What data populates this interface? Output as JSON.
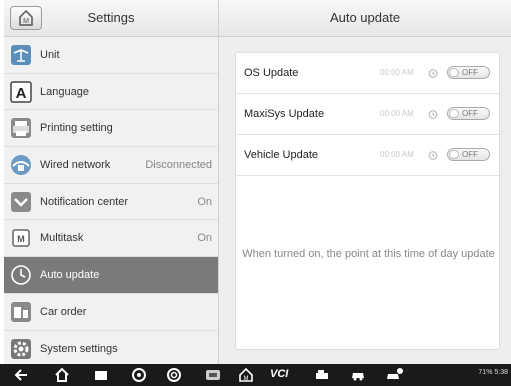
{
  "left_panel": {
    "title": "Settings",
    "items": [
      {
        "label": "Unit",
        "value": "",
        "icon": "scale-icon"
      },
      {
        "label": "Language",
        "value": "",
        "icon": "language-icon"
      },
      {
        "label": "Printing setting",
        "value": "",
        "icon": "printer-icon"
      },
      {
        "label": "Wired network",
        "value": "Disconnected",
        "icon": "network-icon"
      },
      {
        "label": "Notification center",
        "value": "On",
        "icon": "notification-icon"
      },
      {
        "label": "Multitask",
        "value": "On",
        "icon": "multitask-icon"
      },
      {
        "label": "Auto update",
        "value": "",
        "icon": "clock-icon"
      },
      {
        "label": "Car order",
        "value": "",
        "icon": "car-order-icon"
      },
      {
        "label": "System settings",
        "value": "",
        "icon": "gear-icon"
      }
    ]
  },
  "right_panel": {
    "title": "Auto update",
    "updates": [
      {
        "label": "OS Update",
        "time": "00:00 AM",
        "state": "OFF"
      },
      {
        "label": "MaxiSys Update",
        "time": "00:00 AM",
        "state": "OFF"
      },
      {
        "label": "Vehicle Update",
        "time": "00:00 AM",
        "state": "OFF"
      }
    ],
    "hint": "When turned on, the point at this time of day update"
  },
  "bottom_bar": {
    "vci_label": "VCI",
    "status_text": "71% 5:38"
  },
  "colors": {
    "active_item_bg": "#7a7a7a",
    "bottom_bar_bg": "#1a1a1a"
  }
}
